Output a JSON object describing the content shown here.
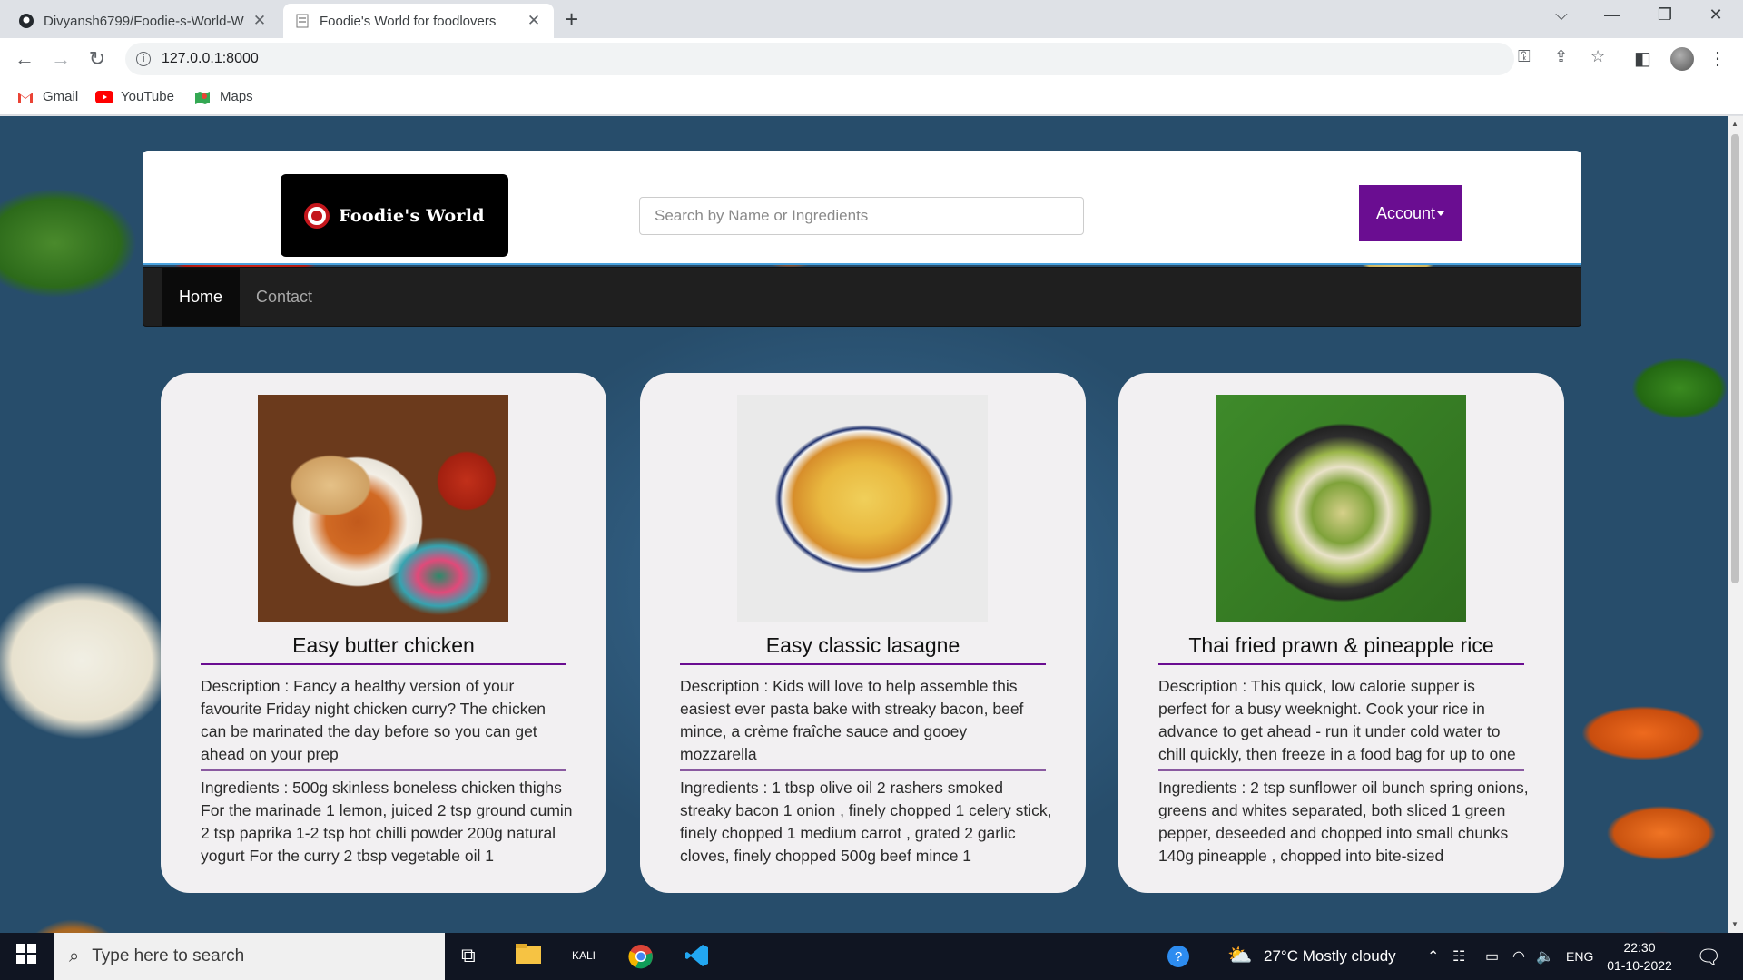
{
  "browser": {
    "tabs": [
      {
        "title": "Divyansh6799/Foodie-s-World-W",
        "icon": "github-icon",
        "active": false
      },
      {
        "title": "Foodie's World for foodlovers",
        "icon": "page-icon",
        "active": true
      }
    ],
    "address": "127.0.0.1:8000",
    "bookmarks": [
      {
        "label": "Gmail",
        "icon": "gmail-icon"
      },
      {
        "label": "YouTube",
        "icon": "youtube-icon"
      },
      {
        "label": "Maps",
        "icon": "maps-icon"
      }
    ]
  },
  "site": {
    "logo_text": "Foodie's World",
    "search_placeholder": "Search by Name or Ingredients",
    "account_label": "Account",
    "nav": [
      {
        "label": "Home",
        "active": true
      },
      {
        "label": "Contact",
        "active": false
      }
    ],
    "colors": {
      "accent": "#6a0d91",
      "nav_bg": "#1f1f1f",
      "card_bg": "#f2f0f2"
    }
  },
  "recipes": [
    {
      "title": "Easy butter chicken",
      "description": "Description : Fancy a healthy version of your favourite Friday night chicken curry? The chicken can be marinated the day before so you can get ahead on your prep",
      "ingredients": "Ingredients : 500g skinless boneless chicken thighs For the marinade 1 lemon, juiced 2 tsp ground cumin 2 tsp paprika 1-2 tsp hot chilli powder 200g natural yogurt For the curry 2 tbsp vegetable oil 1"
    },
    {
      "title": "Easy classic lasagne",
      "description": "Description : Kids will love to help assemble this easiest ever pasta bake with streaky bacon, beef mince, a crème fraîche sauce and gooey mozzarella",
      "ingredients": "Ingredients : 1 tbsp olive oil 2 rashers smoked streaky bacon 1 onion , finely chopped 1 celery stick, finely chopped 1 medium carrot , grated 2 garlic cloves, finely chopped 500g beef mince 1"
    },
    {
      "title": "Thai fried prawn & pineapple rice",
      "description": "Description : This quick, low calorie supper is perfect for a busy weeknight. Cook your rice in advance to get ahead - run it under cold water to chill quickly, then freeze in a food bag for up to one",
      "ingredients": "Ingredients : 2 tsp sunflower oil bunch spring onions, greens and whites separated, both sliced 1 green pepper, deseeded and chopped into small chunks 140g pineapple , chopped into bite-sized"
    }
  ],
  "taskbar": {
    "search_placeholder": "Type here to search",
    "weather": "27°C  Mostly cloudy",
    "lang": "ENG",
    "time": "22:30",
    "date": "01-10-2022"
  }
}
